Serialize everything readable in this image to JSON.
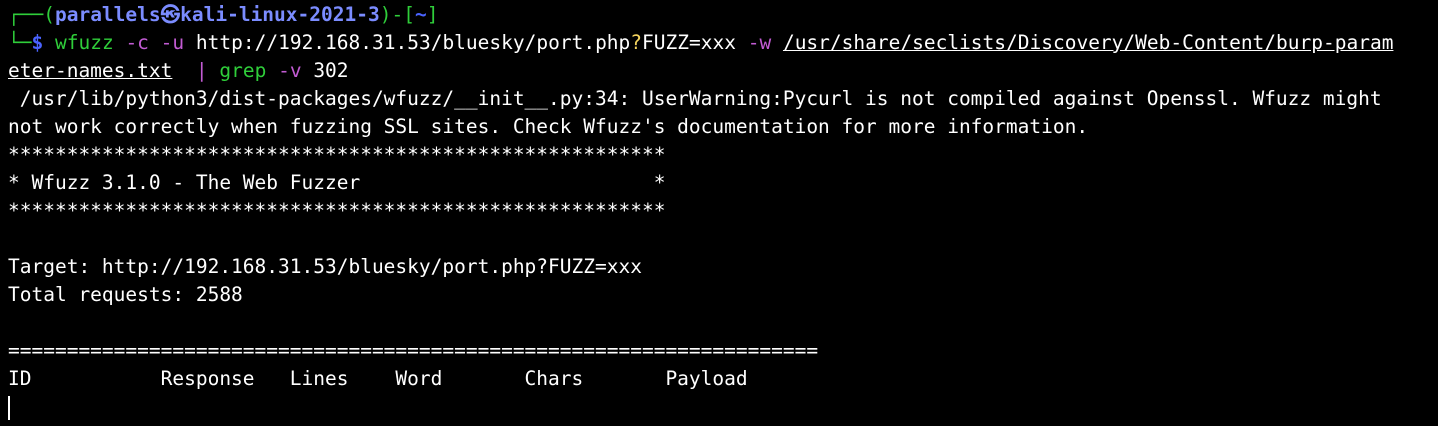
{
  "prompt": {
    "corner_top": "┌──(",
    "user_host": "parallels㉿kali-linux-2021-3",
    "mid": ")-[",
    "cwd": "~",
    "end": "]",
    "corner_bottom": "└─",
    "dollar": "$"
  },
  "command": {
    "tool": "wfuzz",
    "flag_c": "-c",
    "flag_u": "-u",
    "url_prefix": "http://192.168.31.53/bluesky/port.php",
    "url_q": "?",
    "url_suffix": "FUZZ=xxx",
    "flag_w": "-w",
    "wordlist_part1": "/usr/share/seclists/Discovery/Web-Content/burp-param",
    "wordlist_part2": "eter-names.txt",
    "pipe": "|",
    "grep": "grep",
    "grep_flag": "-v",
    "grep_arg": "302"
  },
  "output": {
    "warning_1": " /usr/lib/python3/dist-packages/wfuzz/__init__.py:34: UserWarning:Pycurl is not compiled against Openssl. Wfuzz might",
    "warning_2": "not work correctly when fuzzing SSL sites. Check Wfuzz's documentation for more information.",
    "stars": "********************************************************",
    "banner": "* Wfuzz 3.1.0 - The Web Fuzzer                         *",
    "target": "Target: http://192.168.31.53/bluesky/port.php?FUZZ=xxx",
    "total": "Total requests: 2588",
    "rule": "=====================================================================",
    "header": "ID           Response   Lines    Word       Chars       Payload"
  },
  "colors": {
    "background": "#000000",
    "foreground": "#ffffff",
    "prompt_green": "#2fce3a",
    "prompt_blue": "#7b8cff",
    "flag_magenta": "#c25bd3",
    "query_yellow": "#f4d35e"
  }
}
